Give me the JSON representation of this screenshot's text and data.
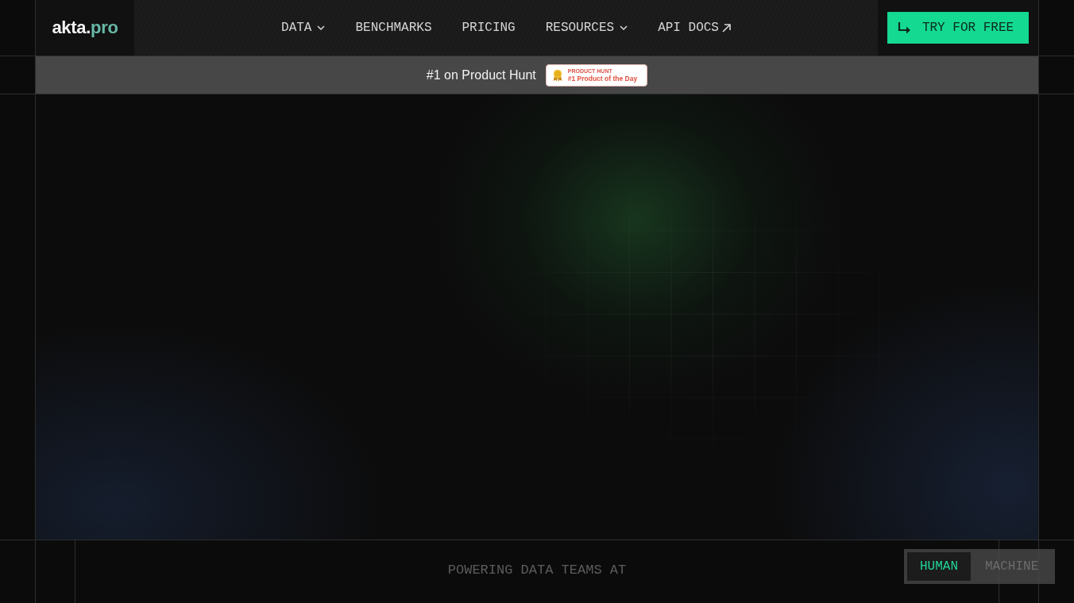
{
  "header": {
    "logo": {
      "text": "akta.",
      "accent": "pro"
    },
    "nav": [
      {
        "label": "DATA",
        "kind": "dropdown"
      },
      {
        "label": "BENCHMARKS",
        "kind": "link"
      },
      {
        "label": "PRICING",
        "kind": "link"
      },
      {
        "label": "RESOURCES",
        "kind": "dropdown"
      },
      {
        "label": "API DOCS",
        "kind": "external"
      }
    ],
    "cta": {
      "label": "TRY FOR FREE"
    }
  },
  "banner": {
    "text": "#1 on Product Hunt",
    "badge": {
      "eyebrow": "PRODUCT HUNT",
      "title": "#1 Product of the Day"
    }
  },
  "footer": {
    "tagline": "POWERING DATA TEAMS AT"
  },
  "mode_toggle": [
    {
      "label": "HUMAN",
      "selected": true
    },
    {
      "label": "MACHINE",
      "selected": false
    }
  ]
}
